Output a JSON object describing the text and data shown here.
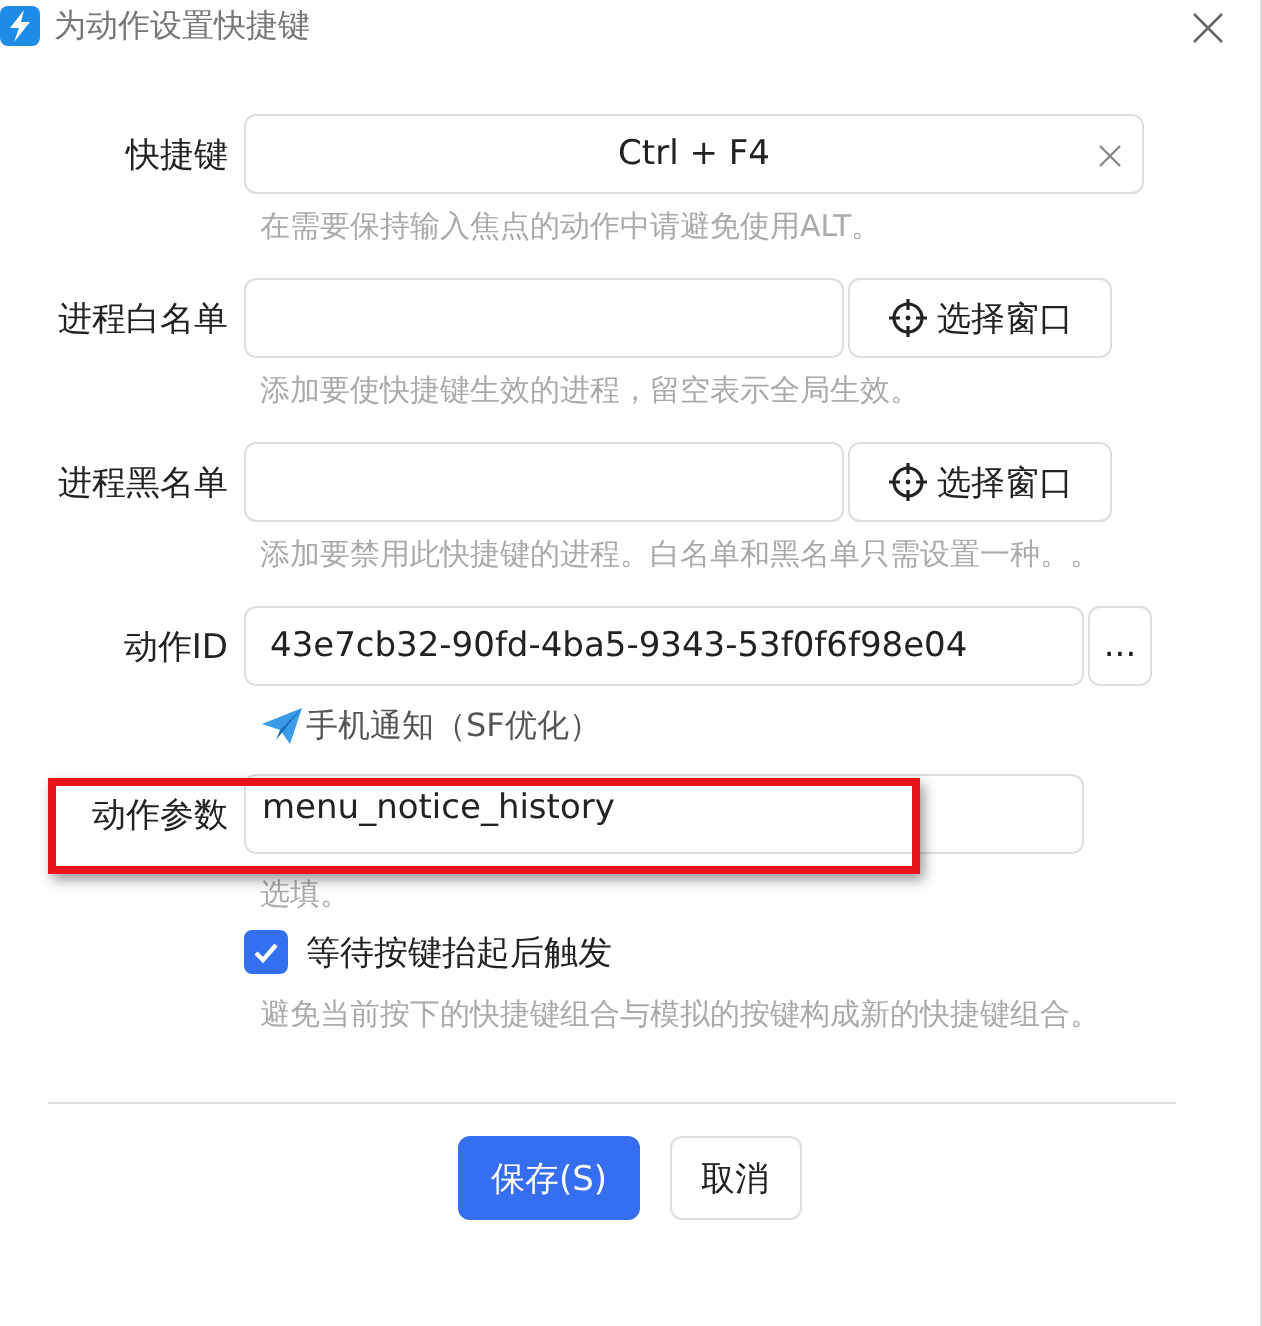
{
  "window": {
    "title": "为动作设置快捷键"
  },
  "fields": [
    {
      "kind": "shortcut",
      "label": "快捷键",
      "value": "Ctrl + F4",
      "hint": "在需要保持输入焦点的动作中请避免使用ALT。"
    },
    {
      "kind": "picker",
      "label": "进程白名单",
      "button": "选择窗口",
      "hint": "添加要使快捷键生效的进程，留空表示全局生效。"
    },
    {
      "kind": "picker",
      "label": "进程黑名单",
      "button": "选择窗口",
      "hint": "添加要禁用此快捷键的进程。白名单和黑名单只需设置一种。。"
    },
    {
      "kind": "action",
      "label": "动作ID",
      "value": "43e7cb32-90fd-4ba5-9343-53f0f6f98e04",
      "button": "...",
      "action_name": "手机通知（SF优化）"
    },
    {
      "kind": "param",
      "label": "动作参数",
      "value": "menu_notice_history",
      "hint": "选填。",
      "highlighted": true
    }
  ],
  "checkbox": {
    "label": "等待按键抬起后触发",
    "checked": true,
    "hint": "避免当前按下的快捷键组合与模拟的按键构成新的快捷键组合。"
  },
  "buttons": [
    {
      "label": "保存(S)",
      "primary": true
    },
    {
      "label": "取消",
      "primary": false
    }
  ]
}
